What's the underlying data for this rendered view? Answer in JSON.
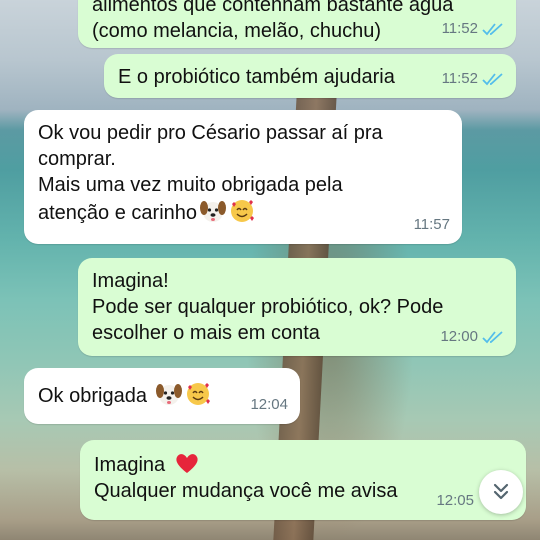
{
  "chat": {
    "messages": [
      {
        "id": "m1",
        "direction": "outgoing",
        "text": "alimentos que contenham bastante água\n(como melancia, melão, chuchu)",
        "time": "11:52",
        "status": "read"
      },
      {
        "id": "m2",
        "direction": "outgoing",
        "text": "E o probiótico também ajudaria",
        "time": "11:52",
        "status": "read"
      },
      {
        "id": "m3",
        "direction": "incoming",
        "text": "Ok vou pedir pro Césario passar aí pra\ncomprar.\nMais uma vez muito obrigada pela\natenção e carinho",
        "emoji": [
          "dog-face-emoji",
          "smiling-face-with-hearts-emoji"
        ],
        "time": "11:57"
      },
      {
        "id": "m4",
        "direction": "outgoing",
        "text": "Imagina!\nPode ser qualquer probiótico, ok? Pode\nescolher o mais em conta",
        "time": "12:00",
        "status": "read"
      },
      {
        "id": "m5",
        "direction": "incoming",
        "text": "Ok obrigada",
        "emoji": [
          "dog-face-emoji",
          "smiling-face-with-hearts-emoji"
        ],
        "time": "12:04"
      },
      {
        "id": "m6",
        "direction": "outgoing",
        "text": "Imagina",
        "emoji_after_first_line": "red-heart-emoji",
        "text2": "Qualquer mudança você me avisa",
        "time": "12:05",
        "status": "read"
      }
    ]
  },
  "colors": {
    "outgoing_bubble": "#d9fdd3",
    "incoming_bubble": "#ffffff",
    "read_ticks": "#53bdeb",
    "timestamp": "#667781"
  },
  "icons": {
    "read_receipt": "double-check-icon",
    "scroll_down": "double-chevron-down-icon"
  }
}
